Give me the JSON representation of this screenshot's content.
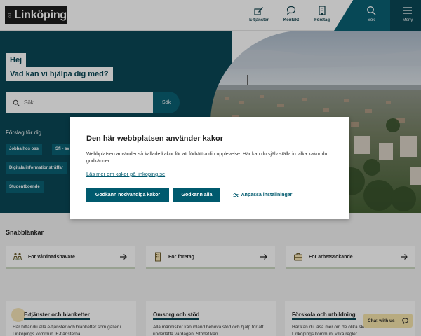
{
  "header": {
    "logo_text": "Linköping",
    "nav": [
      {
        "label": "E-tjänster",
        "icon": "pen-form-icon"
      },
      {
        "label": "Kontakt",
        "icon": "chat-bubble-icon"
      },
      {
        "label": "Företag",
        "icon": "office-building-icon"
      },
      {
        "label": "Sök",
        "icon": "search-icon"
      },
      {
        "label": "Meny",
        "icon": "hamburger-menu-icon"
      }
    ]
  },
  "hero": {
    "greeting": "Hej",
    "question": "Vad kan vi hjälpa dig med?",
    "search_placeholder": "Sök",
    "search_button": "Sök",
    "suggestions_title": "Förslag för dig",
    "suggestions": [
      "Jobba hos oss",
      "Sfi - sv",
      "Digitala informationsträffar",
      "Studentboende"
    ]
  },
  "quicklinks": {
    "title": "Snabblänkar",
    "items": [
      {
        "label": "För vårdnadshavare",
        "icon": "family-icon"
      },
      {
        "label": "För företag",
        "icon": "building-icon"
      },
      {
        "label": "För arbetssökande",
        "icon": "briefcase-icon"
      }
    ]
  },
  "services": [
    {
      "title": "E-tjänster och blanketter",
      "text": "Här hittar du alla e-tjänster och blanketter som gäller i Linköpings kommun. E-tjänsterna"
    },
    {
      "title": "Omsorg och stöd",
      "text": "Alla människor kan ibland behöva stöd och hjälp för att underlätta vardagen. Stödet kan"
    },
    {
      "title": "Förskola och utbildning",
      "text": "Här kan du läsa mer om de olika skolformer som finns i Linköpings kommun, vilka regler"
    }
  ],
  "chat": {
    "label": "Chat with us"
  },
  "cookie_dialog": {
    "title": "Den här webbplatsen använder kakor",
    "body": "Webbplatsen använder så kallade kakor för att förbättra din upplevelse. Här kan du själv ställa in vilka kakor du godkänner.",
    "link": "Läs mer om kakor på linkoping.se",
    "btn_necessary": "Godkänn nödvändiga kakor",
    "btn_all": "Godkänn alla",
    "btn_customize": "Anpassa inställningar"
  },
  "colors": {
    "primary_teal": "#005a6e",
    "dark_teal": "#00404f",
    "chat_yellow": "#f5e3a8"
  }
}
